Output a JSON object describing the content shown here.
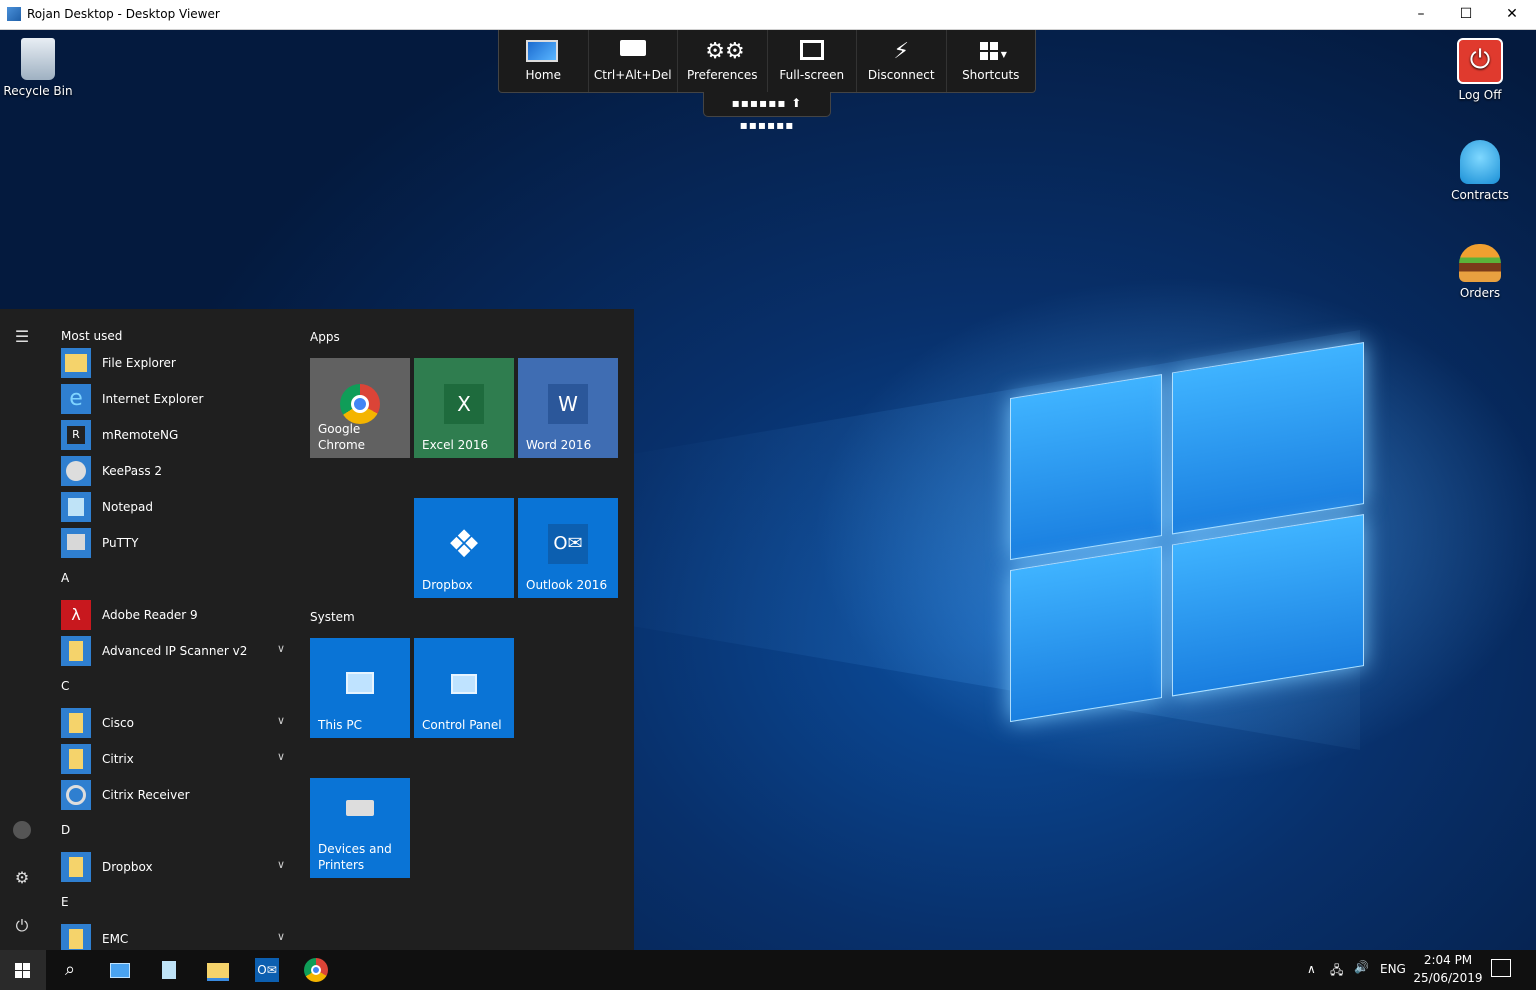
{
  "window": {
    "title": "Rojan Desktop - Desktop Viewer",
    "minimize": "–",
    "maximize": "☐",
    "close": "✕"
  },
  "toolbar": {
    "buttons": [
      {
        "label": "Home",
        "icon": "monitor-icon"
      },
      {
        "label": "Ctrl+Alt+Del",
        "icon": "keyboard-icon"
      },
      {
        "label": "Preferences",
        "icon": "gears-icon"
      },
      {
        "label": "Full-screen",
        "icon": "fullscreen-icon"
      },
      {
        "label": "Disconnect",
        "icon": "plug-icon"
      },
      {
        "label": "Shortcuts",
        "icon": "grid-icon"
      }
    ],
    "handle": "▪▪▪▪▪▪ ⬆ ▪▪▪▪▪▪"
  },
  "desktop_icons": {
    "recycle_bin": "Recycle Bin",
    "log_off": "Log Off",
    "contracts": "Contracts",
    "orders": "Orders"
  },
  "start_menu": {
    "most_used_header": "Most used",
    "most_used": [
      "File Explorer",
      "Internet Explorer",
      "mRemoteNG",
      "KeePass 2",
      "Notepad",
      "PuTTY"
    ],
    "letters": {
      "a": "A",
      "c": "C",
      "d": "D",
      "e": "E"
    },
    "a_items": [
      "Adobe Reader 9",
      "Advanced IP Scanner v2"
    ],
    "c_items": [
      "Cisco",
      "Citrix",
      "Citrix Receiver"
    ],
    "d_items": [
      "Dropbox"
    ],
    "e_items": [
      "EMC"
    ],
    "apps_header": "Apps",
    "system_header": "System",
    "tiles": {
      "chrome": "Google Chrome",
      "excel": "Excel 2016",
      "word": "Word 2016",
      "dropbox": "Dropbox",
      "outlook": "Outlook 2016",
      "this_pc": "This PC",
      "control_panel": "Control Panel",
      "devices": "Devices and Printers"
    }
  },
  "taskbar": {
    "language": "ENG",
    "time": "2:04 PM",
    "date": "25/06/2019"
  }
}
